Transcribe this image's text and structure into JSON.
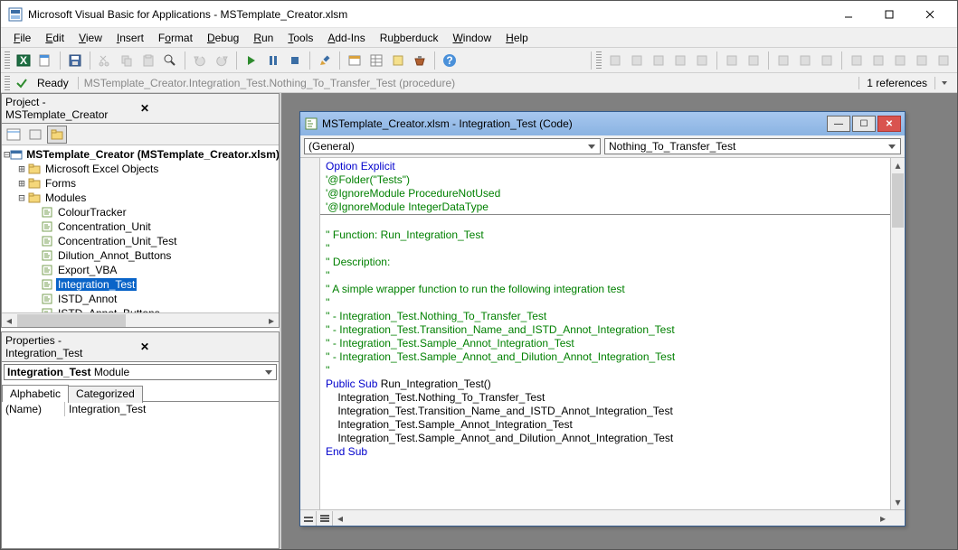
{
  "titlebar": {
    "title": "Microsoft Visual Basic for Applications - MSTemplate_Creator.xlsm"
  },
  "menu": {
    "file": "File",
    "edit": "Edit",
    "view": "View",
    "insert": "Insert",
    "format": "Format",
    "debug": "Debug",
    "run": "Run",
    "tools": "Tools",
    "addins": "Add-Ins",
    "rubberduck": "Rubberduck",
    "window": "Window",
    "help": "Help"
  },
  "readybar": {
    "status": "Ready",
    "path": "MSTemplate_Creator.Integration_Test.Nothing_To_Transfer_Test (procedure)",
    "references": "1 references"
  },
  "projectPanel": {
    "title": "Project - MSTemplate_Creator",
    "root": "MSTemplate_Creator (MSTemplate_Creator.xlsm)",
    "folders": {
      "excelObjects": "Microsoft Excel Objects",
      "forms": "Forms",
      "modules": "Modules"
    },
    "modules": [
      "ColourTracker",
      "Concentration_Unit",
      "Concentration_Unit_Test",
      "Dilution_Annot_Buttons",
      "Export_VBA",
      "Integration_Test",
      "ISTD_Annot",
      "ISTD_Annot_Buttons"
    ],
    "selected": "Integration_Test"
  },
  "propsPanel": {
    "title": "Properties - Integration_Test",
    "comboName": "Integration_Test",
    "comboType": "Module",
    "tabs": {
      "alpha": "Alphabetic",
      "cat": "Categorized"
    },
    "rows": [
      {
        "k": "(Name)",
        "v": "Integration_Test"
      }
    ]
  },
  "codeWindow": {
    "title": "MSTemplate_Creator.xlsm - Integration_Test (Code)",
    "leftCombo": "(General)",
    "rightCombo": "Nothing_To_Transfer_Test",
    "lines": [
      {
        "t": "Option Explicit",
        "c": "kw"
      },
      {
        "t": "'@Folder(\"Tests\")",
        "c": "cm"
      },
      {
        "t": "'@IgnoreModule ProcedureNotUsed",
        "c": "cm"
      },
      {
        "t": "'@IgnoreModule IntegerDataType",
        "c": "cm"
      },
      {
        "t": "__HR__"
      },
      {
        "t": "",
        "c": ""
      },
      {
        "t": "'' Function: Run_Integration_Test",
        "c": "cm"
      },
      {
        "t": "''",
        "c": "cm"
      },
      {
        "t": "'' Description:",
        "c": "cm"
      },
      {
        "t": "''",
        "c": "cm"
      },
      {
        "t": "'' A simple wrapper function to run the following integration test",
        "c": "cm"
      },
      {
        "t": "''",
        "c": "cm"
      },
      {
        "t": "'' - Integration_Test.Nothing_To_Transfer_Test",
        "c": "cm"
      },
      {
        "t": "'' - Integration_Test.Transition_Name_and_ISTD_Annot_Integration_Test",
        "c": "cm"
      },
      {
        "t": "'' - Integration_Test.Sample_Annot_Integration_Test",
        "c": "cm"
      },
      {
        "t": "'' - Integration_Test.Sample_Annot_and_Dilution_Annot_Integration_Test",
        "c": "cm"
      },
      {
        "t": "''",
        "c": "cm"
      },
      {
        "t": "Public Sub Run_Integration_Test()",
        "c": "kw-sub"
      },
      {
        "t": "    Integration_Test.Nothing_To_Transfer_Test",
        "c": ""
      },
      {
        "t": "    Integration_Test.Transition_Name_and_ISTD_Annot_Integration_Test",
        "c": ""
      },
      {
        "t": "    Integration_Test.Sample_Annot_Integration_Test",
        "c": ""
      },
      {
        "t": "    Integration_Test.Sample_Annot_and_Dilution_Annot_Integration_Test",
        "c": ""
      },
      {
        "t": "End Sub",
        "c": "kw"
      }
    ]
  }
}
